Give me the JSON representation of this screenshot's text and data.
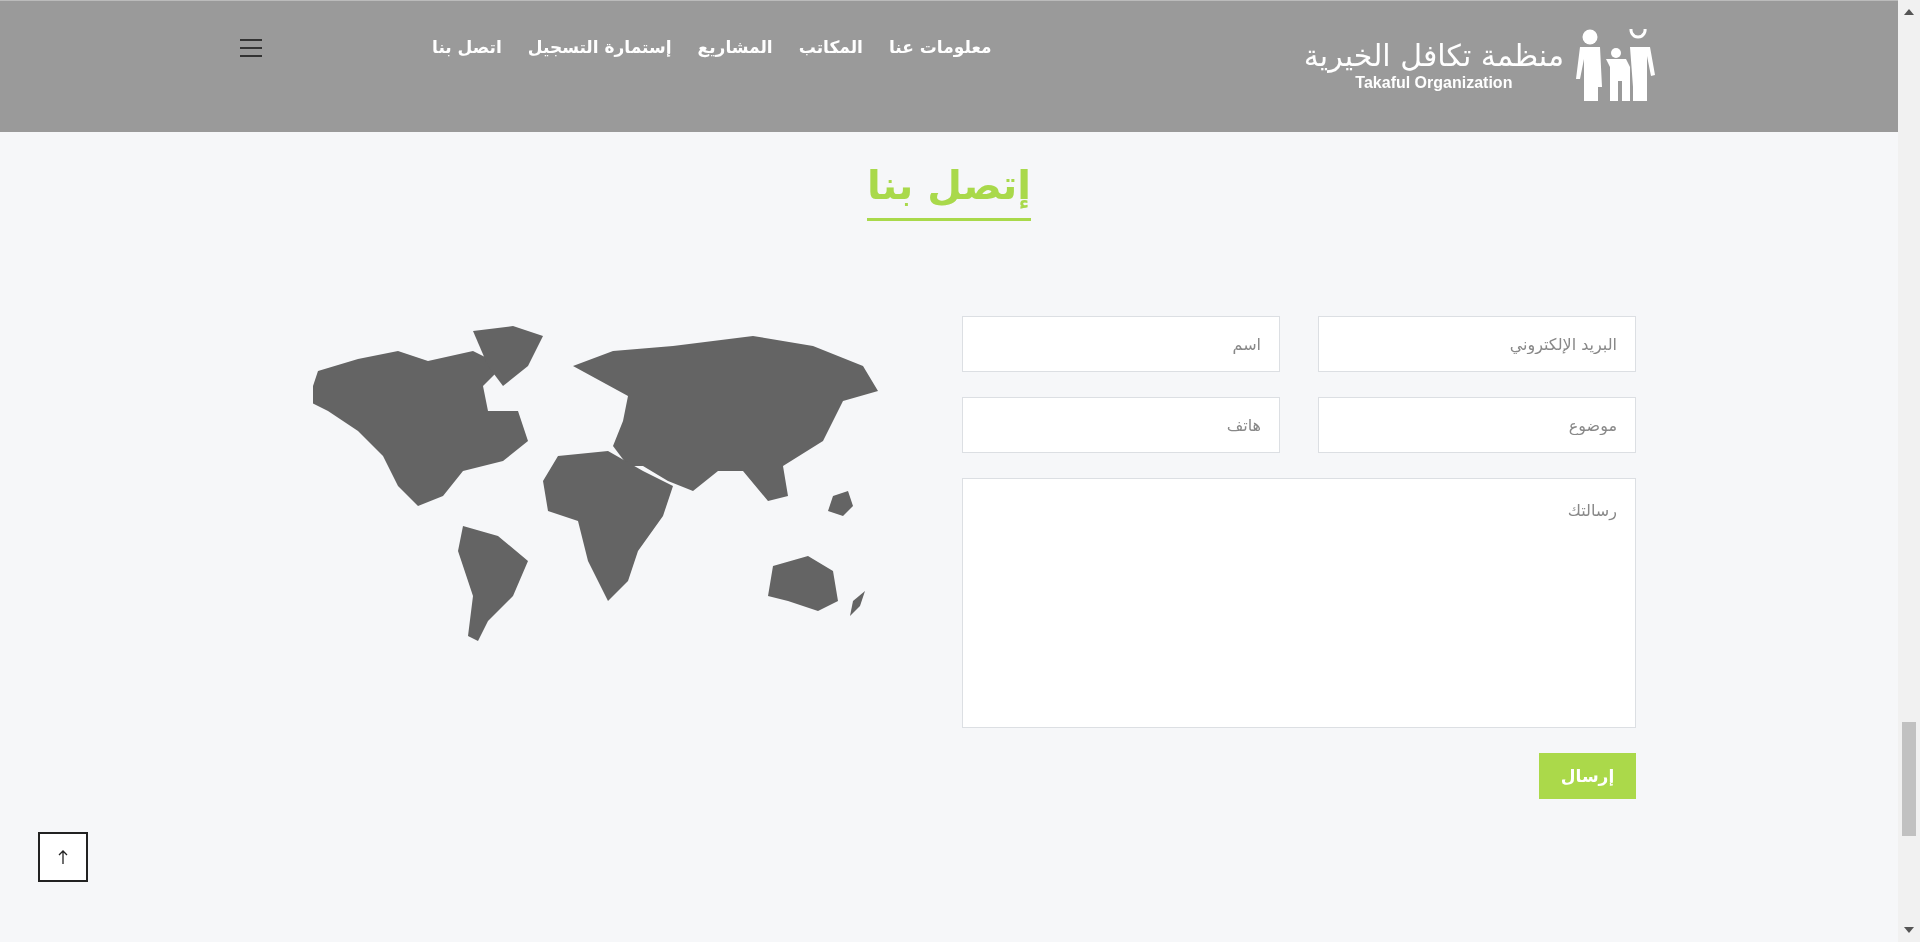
{
  "header": {
    "logo": {
      "arabic": "منظمة تكافل الخيرية",
      "english": "Takaful Organization"
    },
    "nav": [
      {
        "label": "معلومات عنا"
      },
      {
        "label": "المكاتب"
      },
      {
        "label": "المشاريع"
      },
      {
        "label": "إستمارة التسجيل"
      },
      {
        "label": "اتصل بنا"
      }
    ]
  },
  "title": "إتصل بنا",
  "form": {
    "fields": [
      {
        "placeholder": "البريد الإلكتروني"
      },
      {
        "placeholder": "اسم"
      },
      {
        "placeholder": "موضوع"
      },
      {
        "placeholder": "هاتف"
      }
    ],
    "message": {
      "placeholder": "رسالتك"
    },
    "submit": "إرسال"
  }
}
